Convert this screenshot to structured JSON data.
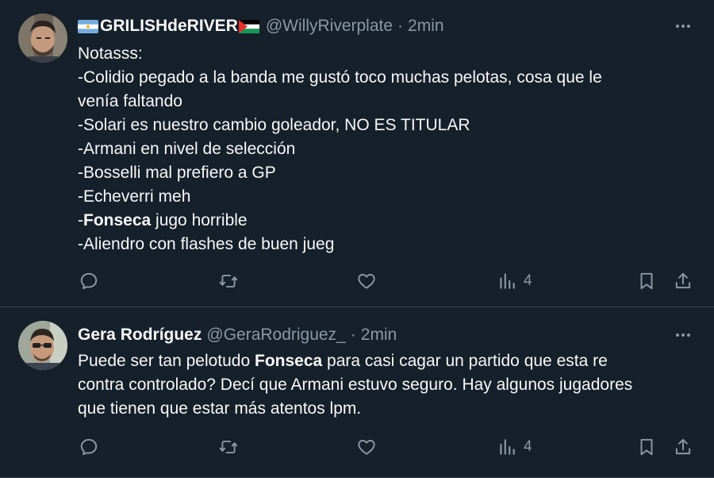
{
  "tweets": [
    {
      "display_name": "GRILISHdeRIVER",
      "handle": "@WillyRiverplate",
      "separator": "·",
      "time": "2min",
      "lines": [
        {
          "pre": "Notasss:",
          "bold": "",
          "post": ""
        },
        {
          "pre": "-Colidio pegado a la banda me gustó toco muchas pelotas, cosa que le",
          "bold": "",
          "post": ""
        },
        {
          "pre": "venía faltando",
          "bold": "",
          "post": ""
        },
        {
          "pre": "-Solari es nuestro cambio goleador, NO ES TITULAR",
          "bold": "",
          "post": ""
        },
        {
          "pre": "-Armani en nivel de selección",
          "bold": "",
          "post": ""
        },
        {
          "pre": "-Bosselli mal prefiero a GP",
          "bold": "",
          "post": ""
        },
        {
          "pre": "-Echeverri meh",
          "bold": "",
          "post": ""
        },
        {
          "pre": "-",
          "bold": "Fonseca",
          "post": " jugo horrible"
        },
        {
          "pre": "-Aliendro con flashes de buen jueg",
          "bold": "",
          "post": ""
        }
      ],
      "actions": {
        "views_count": "4"
      }
    },
    {
      "display_name": "Gera Rodríguez",
      "handle": "@GeraRodriguez_",
      "separator": "·",
      "time": "2min",
      "lines": [
        {
          "pre": "Puede ser tan pelotudo ",
          "bold": "Fonseca",
          "post": " para casi cagar un partido que esta re"
        },
        {
          "pre": "contra controlado? Decí que Armani estuvo seguro. Hay algunos jugadores",
          "bold": "",
          "post": ""
        },
        {
          "pre": "que tienen que estar más atentos lpm.",
          "bold": "",
          "post": ""
        }
      ],
      "actions": {
        "views_count": "4"
      }
    }
  ],
  "colors": {
    "background": "#15202b",
    "text": "#f7f9f9",
    "secondary": "#8b98a5",
    "divider": "#38444d"
  },
  "icons": [
    "reply-icon",
    "retweet-icon",
    "like-icon",
    "views-icon",
    "bookmark-icon",
    "share-icon",
    "more-icon",
    "argentina-flag",
    "palestine-flag"
  ]
}
